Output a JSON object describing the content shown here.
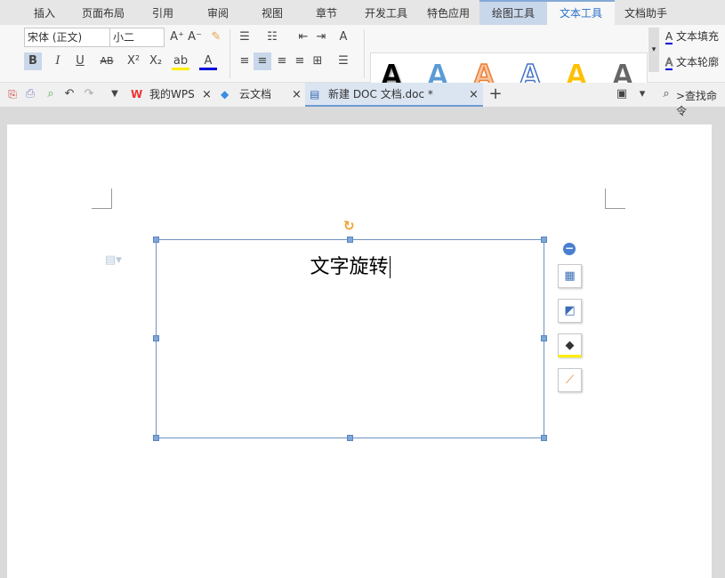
{
  "menu_tabs": [
    "插入",
    "页面布局",
    "引用",
    "审阅",
    "视图",
    "章节",
    "开发工具",
    "特色应用",
    "绘图工具",
    "文本工具",
    "文档助手"
  ],
  "ribbon": {
    "font_name": "宋体 (正文)",
    "font_size": "小二",
    "text_fill": "文本填充",
    "text_outline": "文本轮廓",
    "styles": [
      {
        "color": "#000000"
      },
      {
        "color": "#5b9bd5"
      },
      {
        "color": "#ed7d31"
      },
      {
        "color": "#4472c4"
      },
      {
        "color": "#ffc000"
      },
      {
        "color": "#666666"
      }
    ]
  },
  "doc_tabs": [
    {
      "label": "我的WPS"
    },
    {
      "label": "云文档"
    },
    {
      "label": "新建 DOC 文档.doc *"
    }
  ],
  "search_label": ">查找命令",
  "document": {
    "textbox_text": "文字旋转"
  },
  "colors": {
    "accent": "#2a6fc9",
    "handle": "#7ea6d8",
    "rotate": "#f0a030"
  }
}
